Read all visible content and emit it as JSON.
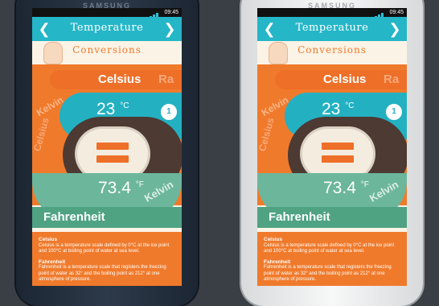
{
  "phones": [
    {
      "brand": "SAMSUNG",
      "time": "09:45",
      "header": {
        "title": "Temperature"
      },
      "subtitle": "Conversions",
      "top_unit": "Celsius",
      "top_ghost": "Ra",
      "kelvin_top": "Kelvin",
      "celsius_value": "23",
      "celsius_unit": "°C",
      "badge": "1",
      "fahrenheit_value": "73.4",
      "fahrenheit_unit": "°F",
      "kelvin_bottom": "Kelvin",
      "celsius_side": "Celsius",
      "bottom_unit": "Fahrenheit",
      "info": [
        {
          "title": "Celsius",
          "text": "Celsius is a temperature scale defined by 0°C at the ice point and 100°C at boiling point of water at sea level."
        },
        {
          "title": "Fahrenheit",
          "text": "Fahrenheit is a temperature scale that registers the freezing point of water as 32° and the boiling point as 212° at one atmosphere of pressure."
        }
      ]
    },
    {
      "brand": "SAMSUNG",
      "time": "09:45",
      "header": {
        "title": "Temperature"
      },
      "subtitle": "Conversions",
      "top_unit": "Celsius",
      "top_ghost": "Ra",
      "kelvin_top": "Kelvin",
      "celsius_value": "23",
      "celsius_unit": "°C",
      "badge": "1",
      "fahrenheit_value": "73.4",
      "fahrenheit_unit": "°F",
      "kelvin_bottom": "Kelvin",
      "celsius_side": "Celsius",
      "bottom_unit": "Fahrenheit",
      "info": [
        {
          "title": "Celsius",
          "text": "Celsius is a temperature scale defined by 0°C at the ice point and 100°C at boiling point of water at sea level."
        },
        {
          "title": "Fahrenheit",
          "text": "Fahrenheit is a temperature scale that registers the freezing point of water as 32° and the boiling point as 212° at one atmosphere of pressure."
        }
      ]
    }
  ],
  "colors": {
    "teal": "#25b6c8",
    "orange": "#f07a2b",
    "brown": "#4d3a33",
    "green": "#6cb69c"
  }
}
